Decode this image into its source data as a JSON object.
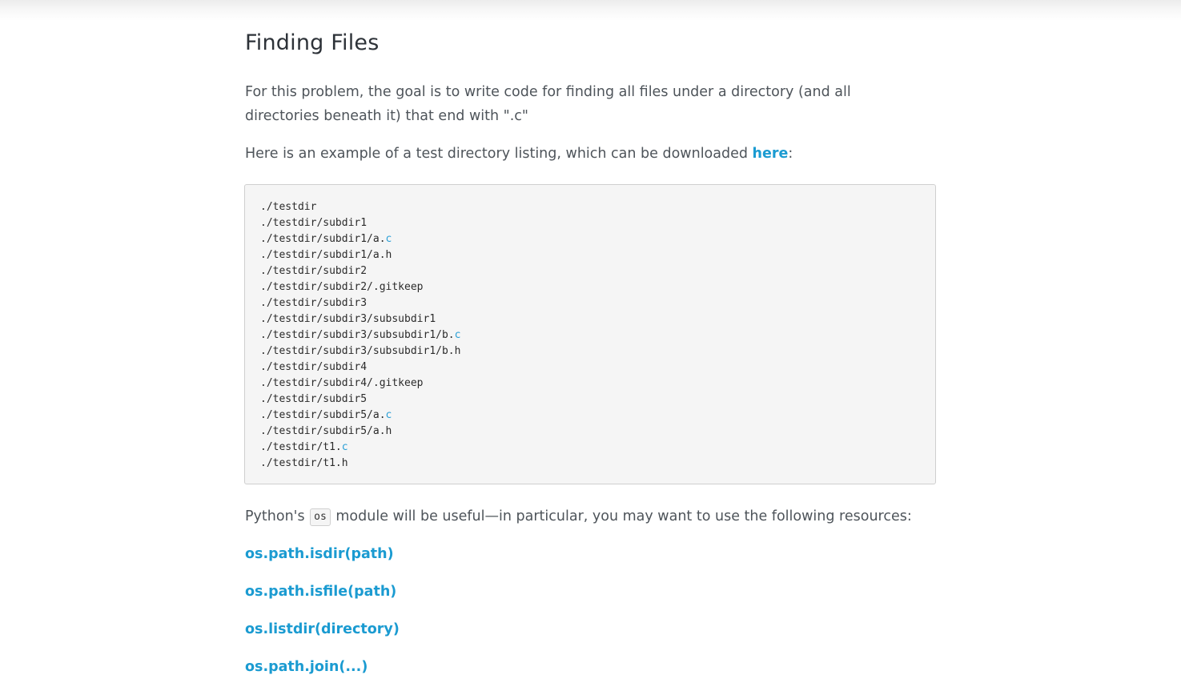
{
  "title": "Finding Files",
  "intro": "For this problem, the goal is to write code for finding all files under a directory (and all directories beneath it) that end with \".c\"",
  "example": {
    "text_before": "Here is an example of a test directory listing, which can be downloaded ",
    "link_label": "here",
    "text_after": ":"
  },
  "listing": [
    {
      "path": "./testdir",
      "ext": ""
    },
    {
      "path": "./testdir/subdir1",
      "ext": ""
    },
    {
      "path": "./testdir/subdir1/a.",
      "ext": "c"
    },
    {
      "path": "./testdir/subdir1/a.h",
      "ext": ""
    },
    {
      "path": "./testdir/subdir2",
      "ext": ""
    },
    {
      "path": "./testdir/subdir2/.gitkeep",
      "ext": ""
    },
    {
      "path": "./testdir/subdir3",
      "ext": ""
    },
    {
      "path": "./testdir/subdir3/subsubdir1",
      "ext": ""
    },
    {
      "path": "./testdir/subdir3/subsubdir1/b.",
      "ext": "c"
    },
    {
      "path": "./testdir/subdir3/subsubdir1/b.h",
      "ext": ""
    },
    {
      "path": "./testdir/subdir4",
      "ext": ""
    },
    {
      "path": "./testdir/subdir4/.gitkeep",
      "ext": ""
    },
    {
      "path": "./testdir/subdir5",
      "ext": ""
    },
    {
      "path": "./testdir/subdir5/a.",
      "ext": "c"
    },
    {
      "path": "./testdir/subdir5/a.h",
      "ext": ""
    },
    {
      "path": "./testdir/t1.",
      "ext": "c"
    },
    {
      "path": "./testdir/t1.h",
      "ext": ""
    }
  ],
  "module_note": {
    "before": "Python's ",
    "code": "os",
    "after": " module will be useful—in particular, you may want to use the following resources:"
  },
  "resources": [
    {
      "label": "os.path.isdir(path)",
      "name": "resource-link-isdir"
    },
    {
      "label": "os.path.isfile(path)",
      "name": "resource-link-isfile"
    },
    {
      "label": "os.listdir(directory)",
      "name": "resource-link-listdir"
    },
    {
      "label": "os.path.join(...)",
      "name": "resource-link-join"
    }
  ],
  "colors": {
    "link": "#1b9bd1",
    "text": "#4e545a",
    "heading": "#2d3238",
    "code_background": "#f5f5f5"
  }
}
